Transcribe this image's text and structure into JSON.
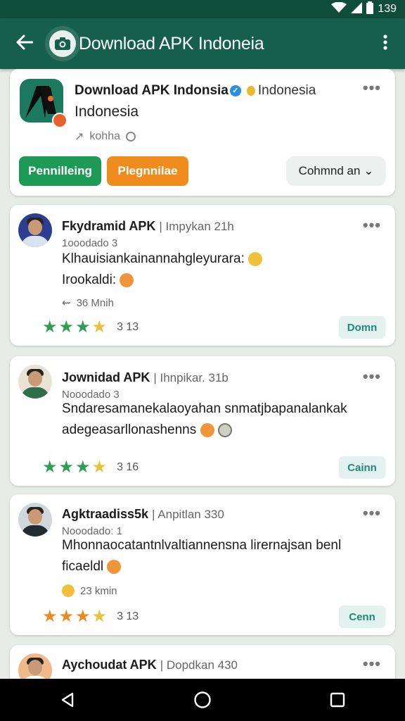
{
  "status_bar": {
    "time": "139"
  },
  "app_bar": {
    "title": "Download APK Indoneia",
    "back_icon": "arrow-left-icon",
    "menu_icon": "more-vert-icon"
  },
  "profile": {
    "name": "Download APK Indonsia",
    "location": "Indonesia",
    "subtitle": "Indonesia",
    "meta": "kohha",
    "buttons": {
      "primary": "Pennilleing",
      "secondary": "Plegnnilae",
      "tertiary": "Cohmnd an"
    }
  },
  "posts": [
    {
      "author": "Fkydramid APK",
      "time": "| Impykan 21h",
      "sub": "1ooodado 3",
      "lines": [
        "Klhauisiankainannahgleyurara:",
        "Irookaldi:"
      ],
      "meta": "36 Mnih",
      "rating": "3 13",
      "action": "Domn"
    },
    {
      "author": "Jownidad APK",
      "time": "| Ihnpikar. 31b",
      "sub": "Nooodado 3",
      "lines": [
        "Sndaresamanekalaoyahan snmatjbapanalankak",
        "adegeasarllonashenns"
      ],
      "meta": "",
      "rating": "3 16",
      "action": "Cainn"
    },
    {
      "author": "Agktraadiss5k",
      "time": "| Anpitlan 330",
      "sub": "Nooodado: 1",
      "lines": [
        "Mhonnaocatantnlvaltiannensna  lirernajsan benl",
        "ficaeldl"
      ],
      "meta": "23 kmin",
      "rating": "3 13",
      "action": "Cenn"
    },
    {
      "author": "Aychoudat APK",
      "time": "| Dopdkan 430",
      "sub": "",
      "lines": [],
      "meta": "",
      "rating": "",
      "action": ""
    }
  ]
}
